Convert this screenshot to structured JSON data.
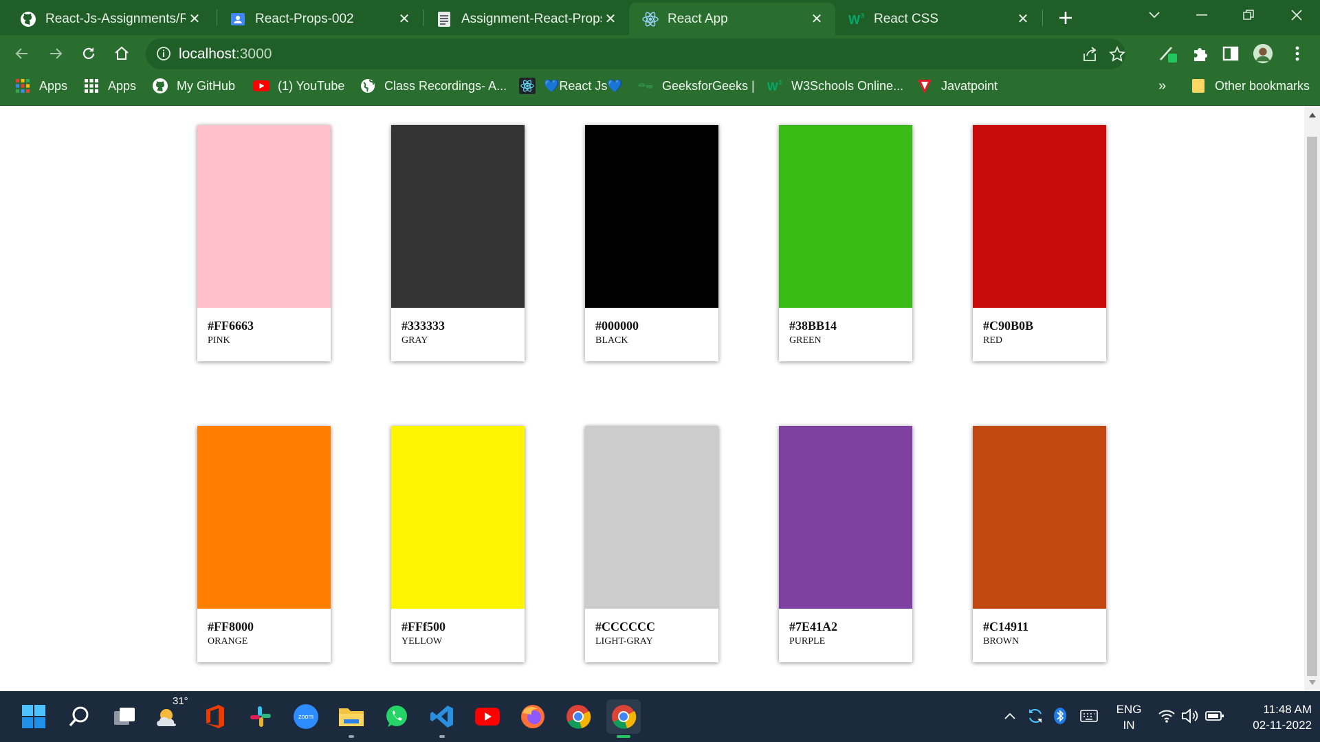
{
  "browser": {
    "tabs": [
      {
        "title": "React-Js-Assignments/Rea",
        "icon": "github-icon",
        "active": false
      },
      {
        "title": "React-Props-002",
        "icon": "classroom-icon",
        "active": false
      },
      {
        "title": "Assignment-React-Props",
        "icon": "document-icon",
        "active": false
      },
      {
        "title": "React App",
        "icon": "react-icon",
        "active": true
      },
      {
        "title": "React CSS",
        "icon": "w3schools-icon",
        "active": false
      }
    ],
    "url_host": "localhost",
    "url_port": ":3000",
    "bookmarks": [
      {
        "label": "Apps",
        "icon": "google-apps-icon"
      },
      {
        "label": "Apps",
        "icon": "apps-grid-icon"
      },
      {
        "label": "My GitHub",
        "icon": "github-icon"
      },
      {
        "label": "(1) YouTube",
        "icon": "youtube-icon"
      },
      {
        "label": "Class Recordings- A...",
        "icon": "globe-icon"
      },
      {
        "label": "💙React Js💙",
        "icon": "react-icon"
      },
      {
        "label": "GeeksforGeeks |",
        "icon": "geeksforgeeks-icon"
      },
      {
        "label": "W3Schools Online...",
        "icon": "w3schools-icon"
      },
      {
        "label": "Javatpoint",
        "icon": "javatpoint-icon"
      }
    ],
    "overflow_label": "»",
    "other_bookmarks": "Other bookmarks",
    "theme_color": "#2a6e2f"
  },
  "colors": [
    {
      "hex": "#FF6663",
      "name": "PINK",
      "swatch": "#ffc0cb"
    },
    {
      "hex": "#333333",
      "name": "GRAY",
      "swatch": "#333333"
    },
    {
      "hex": "#000000",
      "name": "BLACK",
      "swatch": "#000000"
    },
    {
      "hex": "#38BB14",
      "name": "GREEN",
      "swatch": "#38bb14"
    },
    {
      "hex": "#C90B0B",
      "name": "RED",
      "swatch": "#c90b0b"
    },
    {
      "hex": "#FF8000",
      "name": "ORANGE",
      "swatch": "#ff8000"
    },
    {
      "hex": "#FFf500",
      "name": "YELLOW",
      "swatch": "#fff500"
    },
    {
      "hex": "#CCCCCC",
      "name": "LIGHT-GRAY",
      "swatch": "#cccccc"
    },
    {
      "hex": "#7E41A2",
      "name": "PURPLE",
      "swatch": "#7e41a2"
    },
    {
      "hex": "#C14911",
      "name": "BROWN",
      "swatch": "#c14911"
    }
  ],
  "taskbar": {
    "weather_temp": "31°",
    "apps": [
      "windows-start-icon",
      "search-icon",
      "task-view-icon",
      "weather-icon",
      "office-icon",
      "slack-icon",
      "zoom-icon",
      "file-explorer-icon",
      "whatsapp-icon",
      "vscode-icon",
      "youtube-icon",
      "firefox-icon",
      "chrome-icon",
      "chrome-icon"
    ],
    "language_line1": "ENG",
    "language_line2": "IN",
    "time": "11:48 AM",
    "date": "02-11-2022"
  }
}
